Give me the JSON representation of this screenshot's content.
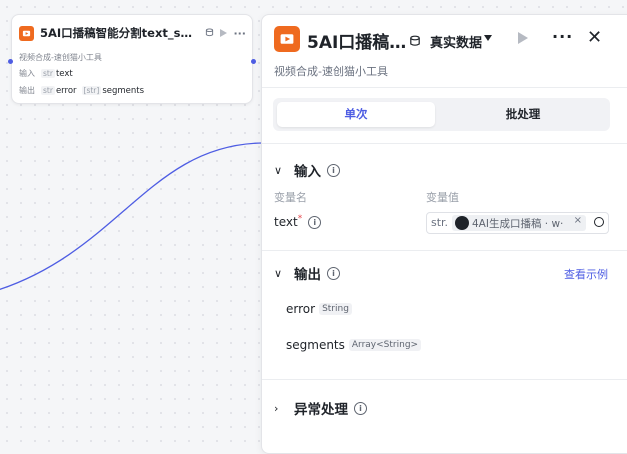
{
  "node": {
    "title": "5AI口播稿智能分割text_split…",
    "description": "视频合成-速创猫小工具",
    "input_label": "输入",
    "output_label": "输出",
    "inputs": [
      {
        "type": "str",
        "name": "text"
      }
    ],
    "outputs": [
      {
        "type": "str",
        "name": "error"
      },
      {
        "type": "[str]",
        "name": "segments"
      }
    ]
  },
  "panel": {
    "title": "5AI口播稿…",
    "data_mode": "真实数据",
    "subtitle": "视频合成-速创猫小工具",
    "tabs": [
      "单次",
      "批处理"
    ],
    "active_tab": "单次",
    "input_section": {
      "title": "输入",
      "col_name": "变量名",
      "col_value": "变量值",
      "variable": {
        "name": "text",
        "required_mark": "*",
        "type": "str.",
        "ref_label": "4AI生成口播稿 · w·",
        "clear": "×"
      }
    },
    "output_section": {
      "title": "输出",
      "link": "查看示例",
      "items": [
        {
          "name": "error",
          "type": "String"
        },
        {
          "name": "segments",
          "type": "Array<String>"
        }
      ]
    },
    "exception_section": {
      "title": "异常处理"
    }
  },
  "colors": {
    "accent": "#4e5de3",
    "brand_icon": "#ef6a1f"
  }
}
